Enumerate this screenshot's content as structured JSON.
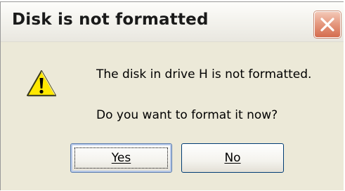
{
  "dialog": {
    "title": "Disk is not formatted",
    "message_line1": "The disk in drive H is not formatted.",
    "message_line2": "Do you want to format it now?",
    "icon": "warning-icon",
    "buttons": {
      "yes_label": "Yes",
      "no_label": "No"
    },
    "colors": {
      "close_button": "#e4967c",
      "warning_fill": "#ffe800"
    }
  }
}
